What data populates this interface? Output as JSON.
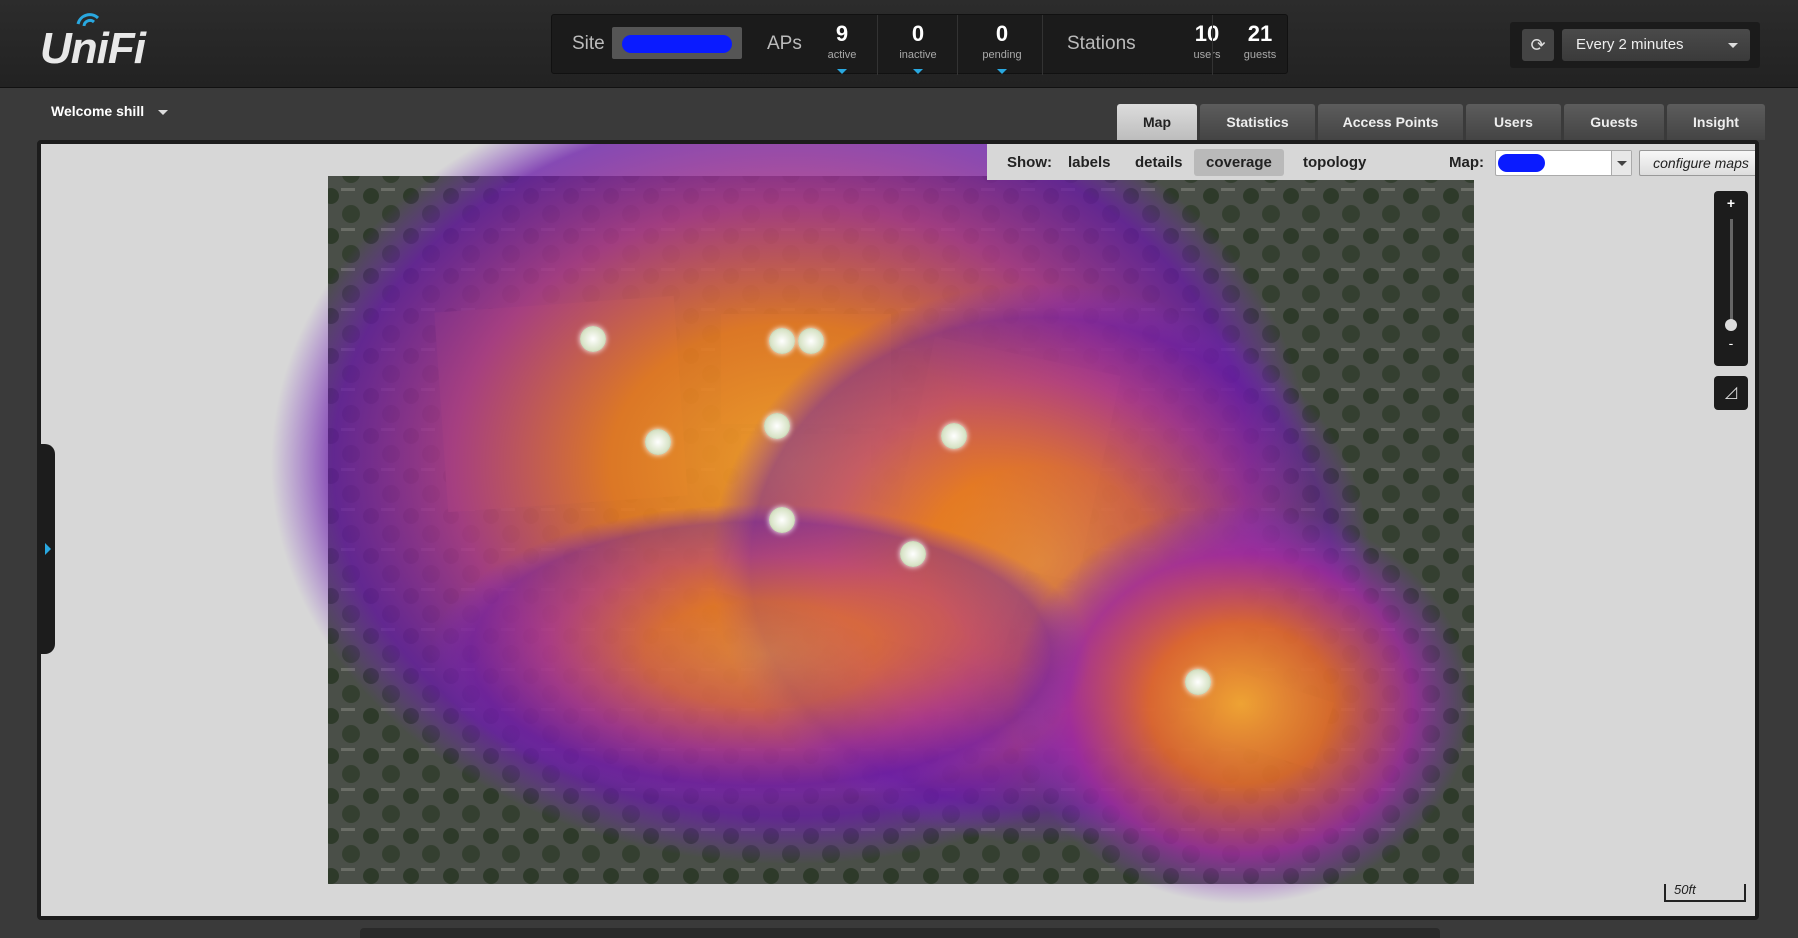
{
  "app": {
    "logo_text": "UniFi"
  },
  "stats": {
    "site_label": "Site",
    "aps_label": "APs",
    "active_count": "9",
    "active_label": "active",
    "inactive_count": "0",
    "inactive_label": "inactive",
    "pending_count": "0",
    "pending_label": "pending",
    "stations_label": "Stations",
    "users_count": "10",
    "users_label": "users",
    "guests_count": "21",
    "guests_label": "guests"
  },
  "refresh": {
    "interval": "Every 2 minutes",
    "icon": "refresh-icon"
  },
  "welcome": {
    "text": "Welcome shill"
  },
  "tabs": [
    {
      "label": "Map"
    },
    {
      "label": "Statistics"
    },
    {
      "label": "Access Points"
    },
    {
      "label": "Users"
    },
    {
      "label": "Guests"
    },
    {
      "label": "Insight"
    }
  ],
  "toolbar": {
    "show_label": "Show:",
    "labels": "labels",
    "details": "details",
    "coverage": "coverage",
    "topology": "topology",
    "map_label": "Map:",
    "configure": "configure maps"
  },
  "zoom": {
    "plus": "+",
    "minus": "-",
    "level": 0.1
  },
  "scale": {
    "label": "50ft"
  },
  "colors": {
    "accent": "#29a8e0",
    "redact": "#0a1bff"
  },
  "access_points": [
    {
      "id": "ap1"
    },
    {
      "id": "ap2"
    },
    {
      "id": "ap3"
    },
    {
      "id": "ap4"
    },
    {
      "id": "ap5"
    },
    {
      "id": "ap6"
    },
    {
      "id": "ap7"
    },
    {
      "id": "ap8"
    },
    {
      "id": "ap9"
    }
  ]
}
